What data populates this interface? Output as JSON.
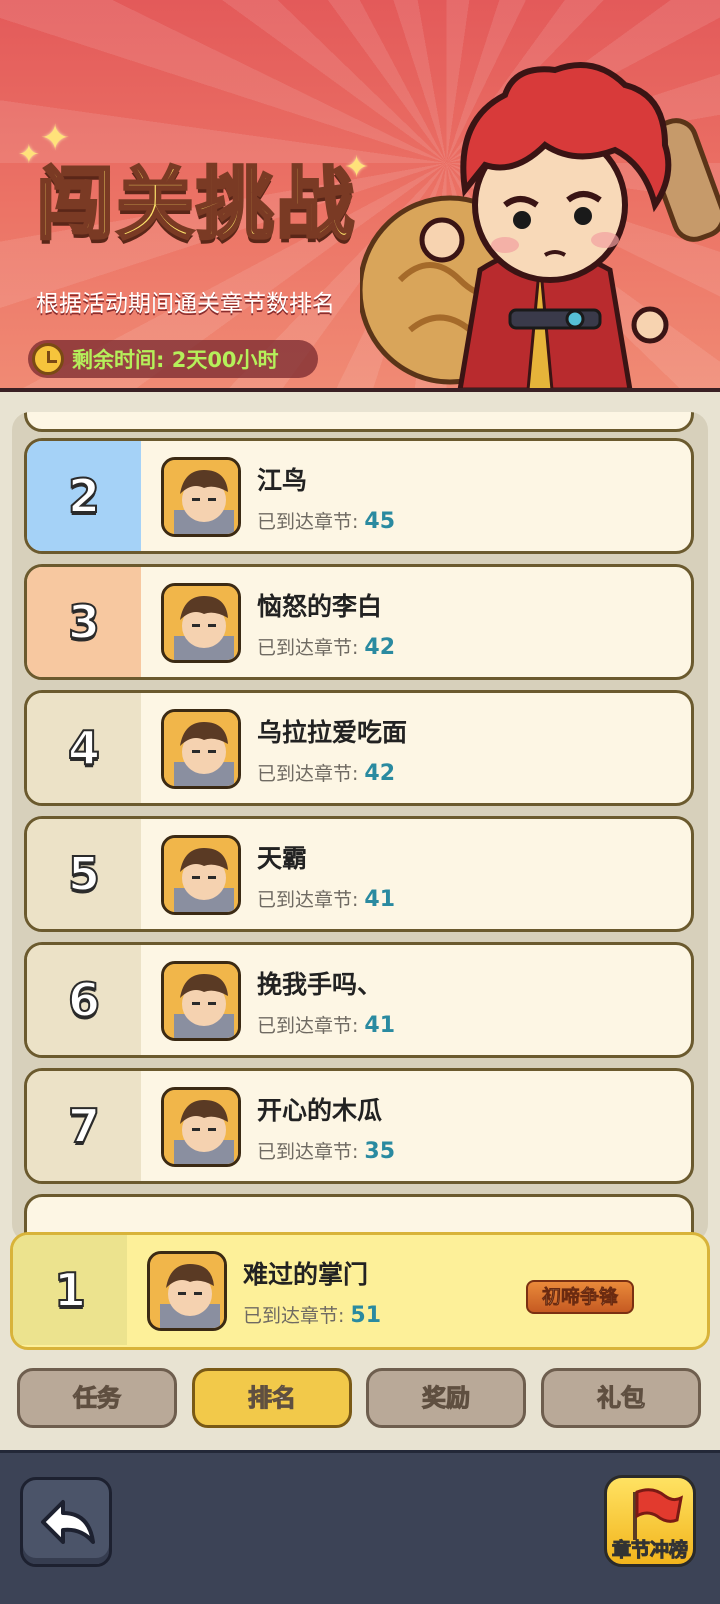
{
  "banner": {
    "title": "闯关挑战",
    "subtitle": "根据活动期间通关章节数排名",
    "timer": "剩余时间: 2天00小时"
  },
  "ranking": {
    "chapter_label": "已到达章节:",
    "rows": [
      {
        "rank": "2",
        "name": "江鸟",
        "chapter": "45",
        "rank_color": "#a5d2f7"
      },
      {
        "rank": "3",
        "name": "恼怒的李白",
        "chapter": "42",
        "rank_color": "#f7c8a0"
      },
      {
        "rank": "4",
        "name": "乌拉拉爱吃面",
        "chapter": "42",
        "rank_color": "#ece2c7"
      },
      {
        "rank": "5",
        "name": "天霸",
        "chapter": "41",
        "rank_color": "#ece2c7"
      },
      {
        "rank": "6",
        "name": "挽我手吗、",
        "chapter": "41",
        "rank_color": "#ece2c7"
      },
      {
        "rank": "7",
        "name": "开心的木瓜",
        "chapter": "35",
        "rank_color": "#ece2c7"
      }
    ],
    "my_row": {
      "rank": "1",
      "name": "难过的掌门",
      "chapter": "51",
      "title_badge": "初啼争锋"
    }
  },
  "tabs": [
    {
      "label": "任务",
      "active": false
    },
    {
      "label": "排名",
      "active": true
    },
    {
      "label": "奖励",
      "active": false
    },
    {
      "label": "礼包",
      "active": false
    }
  ],
  "bottom": {
    "flag_label": "章节冲榜"
  },
  "colors": {
    "accent": "#f2c94a",
    "chapter_number": "#2a8aa0",
    "banner_red": "#e35a5a"
  }
}
